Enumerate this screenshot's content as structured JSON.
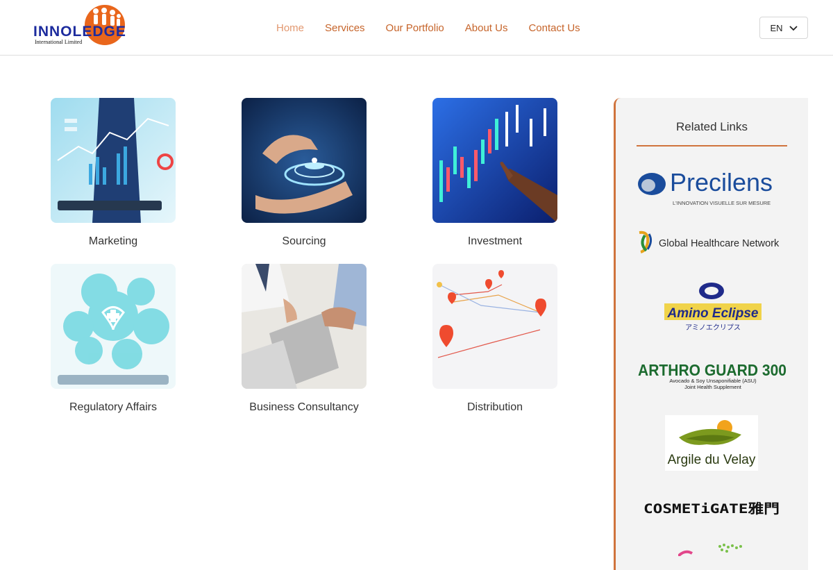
{
  "header": {
    "logo_text": "INNOLEDGE",
    "logo_subtext": "International Limited",
    "nav": [
      {
        "label": "Home",
        "active": true
      },
      {
        "label": "Services",
        "active": false
      },
      {
        "label": "Our Portfolio",
        "active": false
      },
      {
        "label": "About Us",
        "active": false
      },
      {
        "label": "Contact Us",
        "active": false
      }
    ],
    "language": "EN"
  },
  "services": [
    {
      "label": "Marketing",
      "image": "tablet-chart-image"
    },
    {
      "label": "Sourcing",
      "image": "hands-hologram-image"
    },
    {
      "label": "Investment",
      "image": "candlestick-chart-image"
    },
    {
      "label": "Regulatory Affairs",
      "image": "medical-icons-image"
    },
    {
      "label": "Business Consultancy",
      "image": "meeting-documents-image"
    },
    {
      "label": "Distribution",
      "image": "map-pins-image"
    }
  ],
  "related": {
    "title": "Related Links",
    "brands": {
      "precilens": {
        "name": "Precilens",
        "tagline": "L'INNOVATION VISUELLE SUR MESURE"
      },
      "ghn": {
        "name": "Global Healthcare Network"
      },
      "amino": {
        "name": "Amino Eclipse",
        "sub": "アミノエクリプス"
      },
      "arthro": {
        "name": "ARTHRO GUARD  300",
        "line1": "Avocado & Soy Unsaponifiable (ASU)",
        "line2": "Joint Health Supplement"
      },
      "argile": {
        "name": "Argile du Velay"
      },
      "cosmetigate": {
        "name": "COSMETiGATE雅門"
      }
    }
  },
  "colors": {
    "accent": "#c6642a",
    "accent_light": "#e29870",
    "panel": "#f3f3f3",
    "logo_blue": "#1d2c9e",
    "logo_orange": "#e9661c"
  }
}
